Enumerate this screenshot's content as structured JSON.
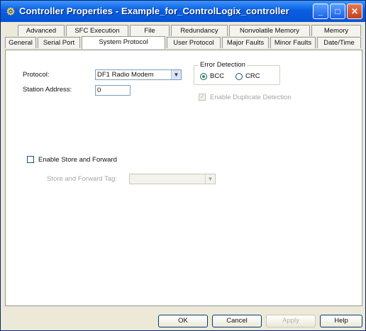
{
  "window": {
    "title": "Controller Properties - Example_for_ControlLogix_controller"
  },
  "tabs": {
    "row1": [
      "Advanced",
      "SFC Execution",
      "File",
      "Redundancy",
      "Nonvolatile Memory",
      "Memory"
    ],
    "row2": [
      "General",
      "Serial Port",
      "System Protocol",
      "User Protocol",
      "Major Faults",
      "Minor Faults",
      "Date/Time"
    ],
    "active": "System Protocol"
  },
  "form": {
    "protocol_label": "Protocol:",
    "protocol_value": "DF1 Radio Modem",
    "station_label": "Station Address:",
    "station_value": "0",
    "error_detection": {
      "legend": "Error Detection",
      "options": [
        "BCC",
        "CRC"
      ],
      "selected": "BCC"
    },
    "duplicate_detection_label": "Enable Duplicate Detection",
    "store_forward_label": "Enable Store and Forward",
    "store_forward_tag_label": "Store and Forward Tag:",
    "store_forward_tag_value": ""
  },
  "buttons": {
    "ok": "OK",
    "cancel": "Cancel",
    "apply": "Apply",
    "help": "Help"
  }
}
